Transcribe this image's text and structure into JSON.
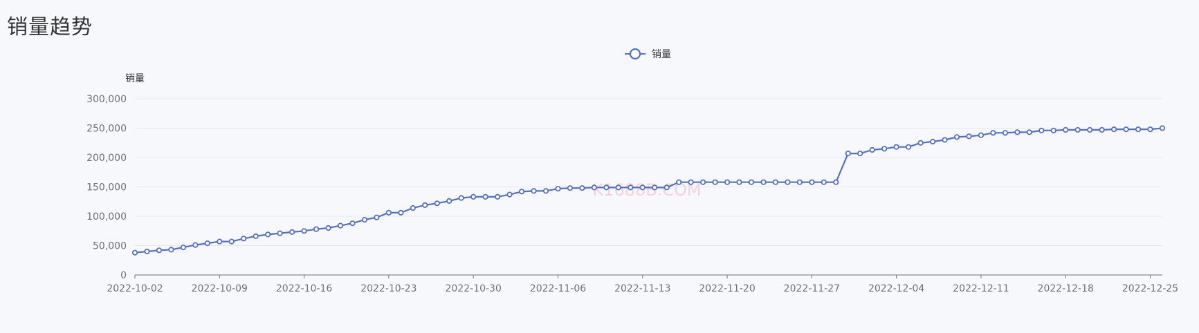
{
  "page": {
    "title": "销量趋势",
    "watermark": "K1688B.COM"
  },
  "chart_data": {
    "type": "line",
    "title": "",
    "xlabel": "",
    "ylabel": "销量",
    "ylim": [
      0,
      300000
    ],
    "y_ticks": [
      0,
      50000,
      100000,
      150000,
      200000,
      250000,
      300000
    ],
    "y_tick_labels": [
      "0",
      "50,000",
      "100,000",
      "150,000",
      "200,000",
      "250,000",
      "300,000"
    ],
    "x_ticks": [
      "2022-10-02",
      "2022-10-09",
      "2022-10-16",
      "2022-10-23",
      "2022-10-30",
      "2022-11-06",
      "2022-11-13",
      "2022-11-20",
      "2022-11-27",
      "2022-12-04",
      "2022-12-11",
      "2022-12-18",
      "2022-12-25"
    ],
    "grid": true,
    "legend_position": "top-center",
    "color": "#5470c6",
    "series": [
      {
        "name": "销量",
        "start_date": "2022-10-02",
        "x": [
          "2022-10-02",
          "2022-10-03",
          "2022-10-04",
          "2022-10-05",
          "2022-10-06",
          "2022-10-07",
          "2022-10-08",
          "2022-10-09",
          "2022-10-10",
          "2022-10-11",
          "2022-10-12",
          "2022-10-13",
          "2022-10-14",
          "2022-10-15",
          "2022-10-16",
          "2022-10-17",
          "2022-10-18",
          "2022-10-19",
          "2022-10-20",
          "2022-10-21",
          "2022-10-22",
          "2022-10-23",
          "2022-10-24",
          "2022-10-25",
          "2022-10-26",
          "2022-10-27",
          "2022-10-28",
          "2022-10-29",
          "2022-10-30",
          "2022-10-31",
          "2022-11-01",
          "2022-11-02",
          "2022-11-03",
          "2022-11-04",
          "2022-11-05",
          "2022-11-06",
          "2022-11-07",
          "2022-11-08",
          "2022-11-09",
          "2022-11-10",
          "2022-11-11",
          "2022-11-12",
          "2022-11-13",
          "2022-11-14",
          "2022-11-15",
          "2022-11-16",
          "2022-11-17",
          "2022-11-18",
          "2022-11-19",
          "2022-11-20",
          "2022-11-21",
          "2022-11-22",
          "2022-11-23",
          "2022-11-24",
          "2022-11-25",
          "2022-11-26",
          "2022-11-27",
          "2022-11-28",
          "2022-11-29",
          "2022-11-30",
          "2022-12-01",
          "2022-12-02",
          "2022-12-03",
          "2022-12-04",
          "2022-12-05",
          "2022-12-06",
          "2022-12-07",
          "2022-12-08",
          "2022-12-09",
          "2022-12-10",
          "2022-12-11",
          "2022-12-12",
          "2022-12-13",
          "2022-12-14",
          "2022-12-15",
          "2022-12-16",
          "2022-12-17",
          "2022-12-18",
          "2022-12-19",
          "2022-12-20",
          "2022-12-21",
          "2022-12-22",
          "2022-12-23",
          "2022-12-24",
          "2022-12-25",
          "2022-12-26"
        ],
        "values": [
          38000,
          40000,
          42000,
          43000,
          47000,
          51000,
          54000,
          57000,
          57000,
          62000,
          66000,
          69000,
          71000,
          73000,
          75000,
          78000,
          80000,
          84000,
          88000,
          94000,
          98000,
          106000,
          106000,
          114000,
          119000,
          122000,
          126000,
          131000,
          133000,
          133000,
          133000,
          137000,
          142000,
          143000,
          143000,
          147000,
          148000,
          148000,
          149000,
          149000,
          149000,
          149000,
          149000,
          149000,
          149000,
          158000,
          158000,
          158000,
          158000,
          158000,
          158000,
          158000,
          158000,
          158000,
          158000,
          158000,
          158000,
          158000,
          158000,
          207000,
          207000,
          213000,
          215000,
          218000,
          218000,
          225000,
          227000,
          230000,
          235000,
          236000,
          238000,
          242000,
          242000,
          243000,
          243000,
          246000,
          246000,
          247000,
          247000,
          247000,
          247000,
          248000,
          248000,
          248000,
          248000,
          250000
        ]
      }
    ]
  }
}
